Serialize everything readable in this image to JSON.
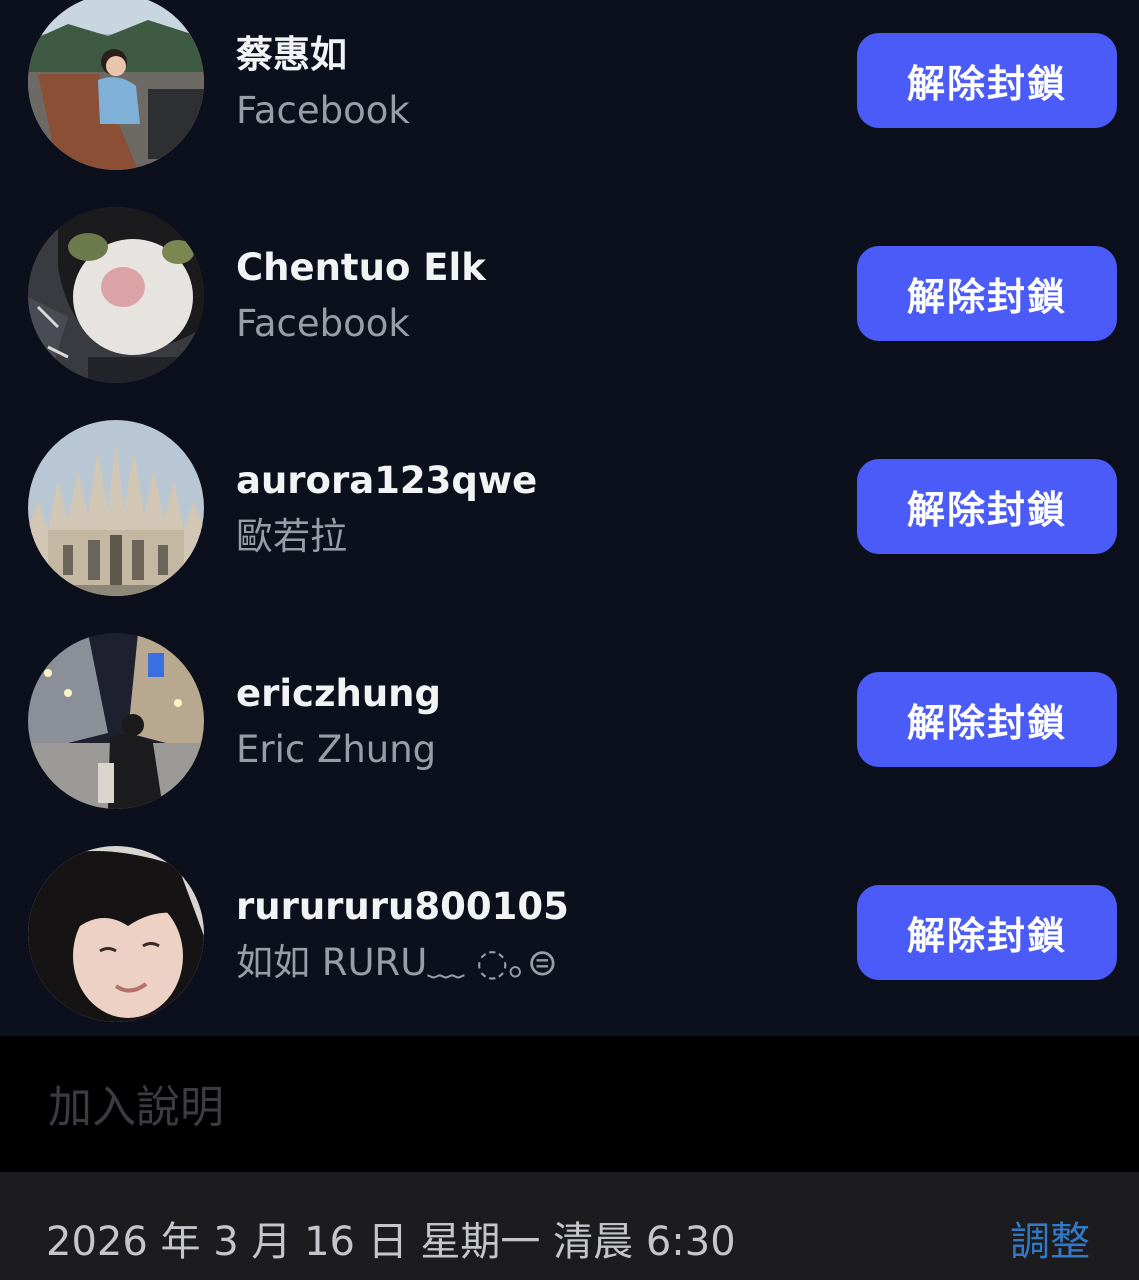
{
  "blocked_list": {
    "items": [
      {
        "username": "蔡惠如",
        "full_name": "Facebook",
        "button_label": "解除封鎖",
        "avatar": "woman-on-terrace-avatar"
      },
      {
        "username": "Chentuo Elk",
        "full_name": "Facebook",
        "button_label": "解除封鎖",
        "avatar": "cat-face-avatar"
      },
      {
        "username": "aurora123qwe",
        "full_name": "歐若拉",
        "button_label": "解除封鎖",
        "avatar": "cathedral-avatar"
      },
      {
        "username": "ericzhung",
        "full_name": "Eric Zhung",
        "button_label": "解除封鎖",
        "avatar": "night-street-lights-avatar"
      },
      {
        "username": "rurururu800105",
        "full_name": "如如 RURU﹏ ◌｡⊜",
        "button_label": "解除封鎖",
        "avatar": "smiling-girl-avatar"
      }
    ]
  },
  "caption": {
    "placeholder": "加入說明"
  },
  "schedule": {
    "date_text": "2026 年 3 月 16 日 星期一 清晨 6:30",
    "adjust_label": "調整"
  },
  "colors": {
    "list_background": "#0c101c",
    "button_accent": "#4a5bf7",
    "link_blue": "#3478c6",
    "secondary_text": "#9a9da6"
  }
}
